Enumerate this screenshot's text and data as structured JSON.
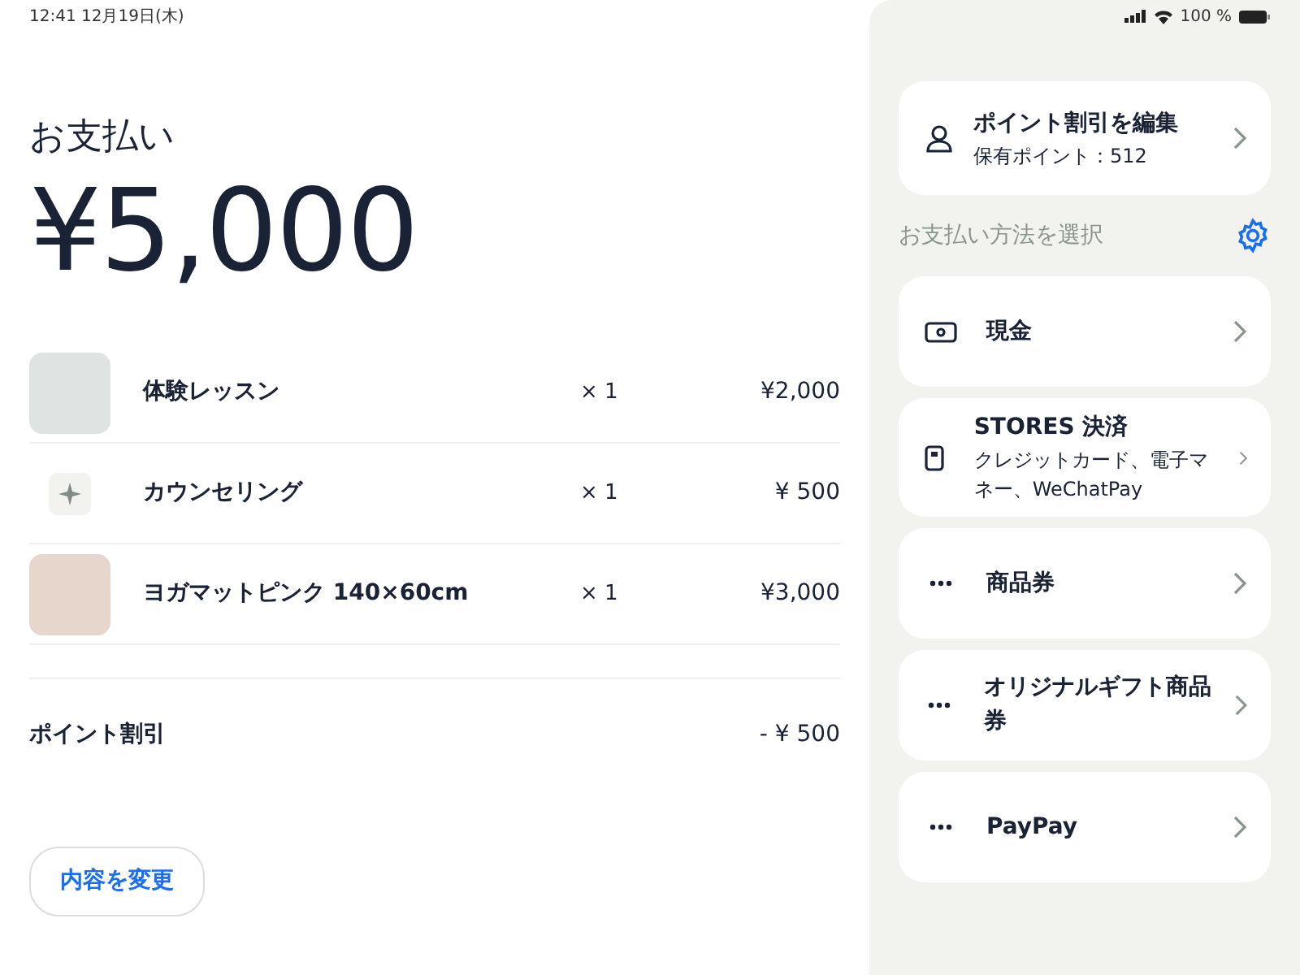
{
  "status_bar": {
    "time": "12:41 12月19日(木)",
    "battery": "100 %"
  },
  "payment": {
    "title": "お支払い",
    "total": "¥5,000",
    "items": [
      {
        "kind": "photo",
        "name": "体験レッスン",
        "qty": "× 1",
        "price": "¥2,000"
      },
      {
        "kind": "icon",
        "name": "カウンセリング",
        "qty": "× 1",
        "price": "¥ 500"
      },
      {
        "kind": "photo",
        "name": "ヨガマットピンク 140×60cm",
        "qty": "× 1",
        "price": "¥3,000"
      }
    ],
    "discount": {
      "label": "ポイント割引",
      "amount": "- ¥ 500"
    },
    "change_button": "内容を変更"
  },
  "points": {
    "title": "ポイント割引を編集",
    "subtitle": "保有ポイント：512"
  },
  "methods_heading": "お支払い方法を選択",
  "methods": [
    {
      "kind": "cash",
      "title": "現金"
    },
    {
      "kind": "terminal",
      "title": "STORES 決済",
      "subtitle": "クレジットカード、電子マネー、WeChatPay"
    },
    {
      "kind": "more",
      "title": "商品券"
    },
    {
      "kind": "more",
      "title": "オリジナルギフト商品券"
    },
    {
      "kind": "more",
      "title": "PayPay"
    }
  ]
}
